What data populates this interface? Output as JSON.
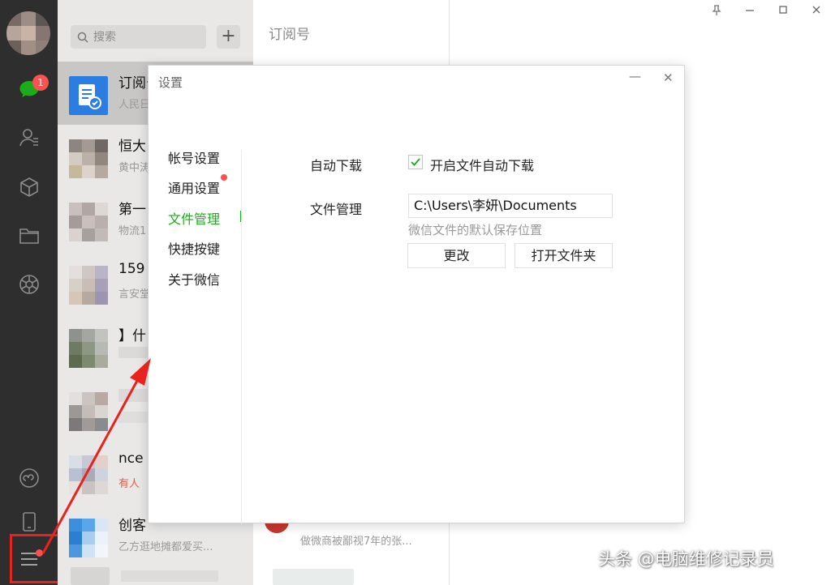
{
  "nav": {
    "chat_badge": "1",
    "icons": [
      "chat-icon",
      "contacts-icon",
      "favorites-icon",
      "folder-icon",
      "moments-icon",
      "mini-program-icon",
      "phone-icon",
      "menu-icon"
    ]
  },
  "search": {
    "placeholder": "搜索",
    "add_label": "+"
  },
  "chat_list": {
    "items": [
      {
        "title": "订阅号",
        "sub": "人民日"
      },
      {
        "title": "恒大",
        "sub": "黄中涛"
      },
      {
        "title": "第一",
        "sub": "物流1"
      },
      {
        "title": "159",
        "sub": "言安堂"
      },
      {
        "title": "】什",
        "sub": ""
      },
      {
        "title": "",
        "sub": ""
      },
      {
        "title": "nce",
        "sub": "有人"
      },
      {
        "title": "创客",
        "sub": "乙方逛地摊都爱买..."
      }
    ],
    "extra_sub": "做微商被鄙视7年的张..."
  },
  "right_panel": {
    "title": "订阅号"
  },
  "dialog": {
    "title": "设置",
    "minimize_label": "—",
    "close_label": "✕",
    "menu": [
      "帐号设置",
      "通用设置",
      "文件管理",
      "快捷按键",
      "关于微信"
    ],
    "active_menu": "文件管理",
    "auto_download_label": "自动下载",
    "auto_download_option": "开启文件自动下载",
    "auto_download_checked": true,
    "file_manage_label": "文件管理",
    "file_path": "C:\\Users\\李妍\\Documents",
    "file_hint": "微信文件的默认保存位置",
    "change_button": "更改",
    "open_folder_button": "打开文件夹"
  },
  "window_controls": [
    "pin-icon",
    "minimize-icon",
    "maximize-icon",
    "close-icon"
  ],
  "watermark": "头条 @电脑维修记录员",
  "colors": {
    "accent_green": "#1aad19",
    "badge_red": "#fa5151",
    "annotation_red": "#e8231f",
    "nav_bg": "#2e2e2e"
  }
}
